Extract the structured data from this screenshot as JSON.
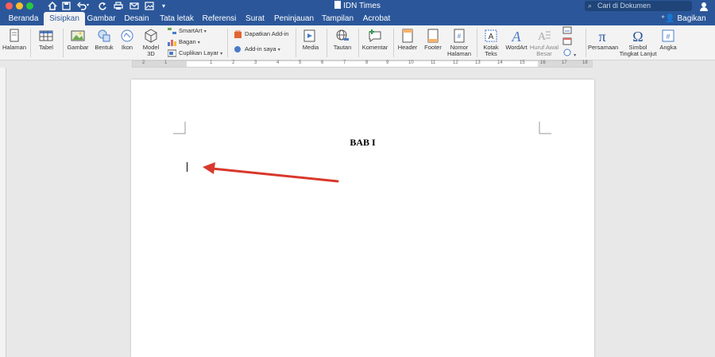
{
  "window": {
    "title": "IDN Times",
    "search_placeholder": "Cari di Dokumen",
    "share_label": "Bagikan"
  },
  "tabs": [
    {
      "label": "Beranda",
      "active": false
    },
    {
      "label": "Sisipkan",
      "active": true
    },
    {
      "label": "Gambar",
      "active": false
    },
    {
      "label": "Desain",
      "active": false
    },
    {
      "label": "Tata letak",
      "active": false
    },
    {
      "label": "Referensi",
      "active": false
    },
    {
      "label": "Surat",
      "active": false
    },
    {
      "label": "Peninjauan",
      "active": false
    },
    {
      "label": "Tampilan",
      "active": false
    },
    {
      "label": "Acrobat",
      "active": false
    }
  ],
  "ribbon": {
    "halaman": "Halaman",
    "tabel": "Tabel",
    "gambar": "Gambar",
    "bentuk": "Bentuk",
    "ikon": "Ikon",
    "model3d_1": "Model",
    "model3d_2": "3D",
    "smartart": "SmartArt",
    "bagan": "Bagan",
    "cuplikan": "Cuplikan Layar",
    "dapatkan_addin": "Dapatkan Add-in",
    "addin_saya": "Add-in saya",
    "media": "Media",
    "tautan": "Tautan",
    "komentar": "Komentar",
    "header": "Header",
    "footer": "Footer",
    "nomor_1": "Nomor",
    "nomor_2": "Halaman",
    "kotak_1": "Kotak",
    "kotak_2": "Teks",
    "wordart": "WordArt",
    "huruf_1": "Huruf Awal",
    "huruf_2": "Besar",
    "persamaan": "Persamaan",
    "simbol_1": "Simbol",
    "simbol_2": "Tingkat Lanjut",
    "angka": "Angka"
  },
  "ruler_numbers": [
    "2",
    "1",
    "1",
    "2",
    "3",
    "4",
    "5",
    "6",
    "7",
    "8",
    "9",
    "10",
    "11",
    "12",
    "13",
    "14",
    "15",
    "16",
    "17",
    "18"
  ],
  "document": {
    "heading": "BAB I"
  },
  "colors": {
    "brand": "#2b579a",
    "annotation_arrow": "#d9382b"
  }
}
